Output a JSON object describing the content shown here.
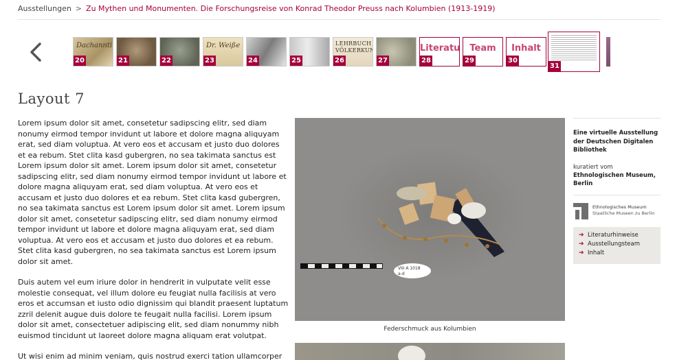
{
  "breadcrumb": {
    "items": [
      "Ausstellungen",
      "Zu Mythen und Monumenten. Die Forschungsreise von Konrad Theodor Preuss nach Kolumbien (1913-1919)"
    ],
    "separator": ">"
  },
  "gallery": {
    "prev_icon": "chevron-left-icon",
    "thumbnails": [
      {
        "number": "20",
        "kind": "image",
        "scribble": "Dachanntiras"
      },
      {
        "number": "21",
        "kind": "image"
      },
      {
        "number": "22",
        "kind": "image"
      },
      {
        "number": "23",
        "kind": "image",
        "scribble": "Dr. Weiße"
      },
      {
        "number": "24",
        "kind": "image"
      },
      {
        "number": "25",
        "kind": "image"
      },
      {
        "number": "26",
        "kind": "image",
        "book": "LEHRBUCH\nVÖLKERKUND"
      },
      {
        "number": "27",
        "kind": "image"
      },
      {
        "number": "28",
        "kind": "text",
        "title": "Literatur"
      },
      {
        "number": "29",
        "kind": "text",
        "title": "Team"
      },
      {
        "number": "30",
        "kind": "text",
        "title": "Inhalt"
      },
      {
        "number": "31",
        "kind": "page",
        "active": true
      }
    ]
  },
  "page": {
    "title": "Layout 7",
    "paragraphs": [
      "Lorem ipsum dolor sit amet, consetetur sadipscing elitr, sed diam nonumy eirmod tempor invidunt ut labore et dolore magna aliquyam erat, sed diam voluptua. At vero eos et accusam et justo duo dolores et ea rebum. Stet clita kasd gubergren, no sea takimata sanctus est Lorem ipsum dolor sit amet. Lorem ipsum dolor sit amet, consetetur sadipscing elitr, sed diam nonumy eirmod tempor invidunt ut labore et dolore magna aliquyam erat, sed diam voluptua. At vero eos et accusam et justo duo dolores et ea rebum. Stet clita kasd gubergren, no sea takimata sanctus est Lorem ipsum dolor sit amet. Lorem ipsum dolor sit amet, consetetur sadipscing elitr, sed diam nonumy eirmod tempor invidunt ut labore et dolore magna aliquyam erat, sed diam voluptua. At vero eos et accusam et justo duo dolores et ea rebum. Stet clita kasd gubergren, no sea takimata sanctus est Lorem ipsum dolor sit amet.",
      "Duis autem vel eum iriure dolor in hendrerit in vulputate velit esse molestie consequat, vel illum dolore eu feugiat nulla facilisis at vero eros et accumsan et iusto odio dignissim qui blandit praesent luptatum zzril delenit augue duis dolore te feugait nulla facilisi. Lorem ipsum dolor sit amet, consectetuer adipiscing elit, sed diam nonummy nibh euismod tincidunt ut laoreet dolore magna aliquam erat volutpat.",
      "Ut wisi enim ad minim veniam, quis nostrud exerci tation ullamcorper"
    ],
    "figure_caption": "Federschmuck aus Kolumbien",
    "figure_tag_text": "VIII A 1018\na-d"
  },
  "sidebar": {
    "intro": "Eine virtuelle Ausstellung der Deutschen Digitalen Bibliothek",
    "curated_label": "kuratiert vom",
    "curated_by": "Ethnologischen Museum, Berlin",
    "museum_logo": {
      "name": "Ethnologisches Museum",
      "subtitle": "Staatliche Museen zu Berlin"
    },
    "links": [
      {
        "label": "Literaturhinweise",
        "icon": "arrow-right-icon"
      },
      {
        "label": "Ausstellungsteam",
        "icon": "arrow-right-icon"
      },
      {
        "label": "Inhalt",
        "icon": "arrow-right-icon"
      }
    ]
  },
  "colors": {
    "accent": "#a5003b",
    "accent_light": "#c84377",
    "sidebar_box": "#ebe9e6",
    "rule": "#e3e3e3"
  }
}
